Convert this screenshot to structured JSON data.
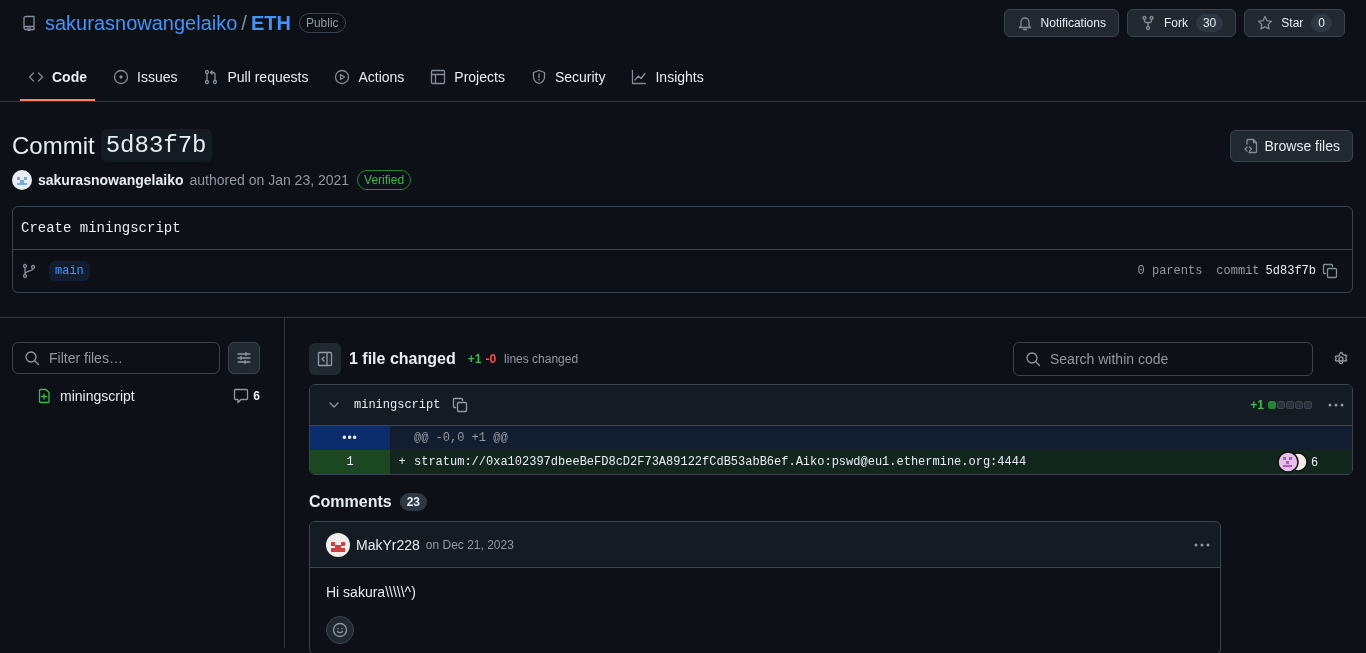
{
  "repo": {
    "owner": "sakurasnowangelaiko",
    "separator": "/",
    "name": "ETH",
    "visibility": "Public"
  },
  "repo_actions": [
    {
      "kind": "notifications",
      "label": "Notifications"
    },
    {
      "kind": "fork",
      "label": "Fork",
      "count": "30"
    },
    {
      "kind": "star",
      "label": "Star",
      "count": "0"
    }
  ],
  "tabs": [
    {
      "kind": "code",
      "label": "Code",
      "selected": true
    },
    {
      "kind": "issues",
      "label": "Issues",
      "selected": false
    },
    {
      "kind": "pulls",
      "label": "Pull requests",
      "selected": false
    },
    {
      "kind": "actions",
      "label": "Actions",
      "selected": false
    },
    {
      "kind": "projects",
      "label": "Projects",
      "selected": false
    },
    {
      "kind": "security",
      "label": "Security",
      "selected": false
    },
    {
      "kind": "insights",
      "label": "Insights",
      "selected": false
    }
  ],
  "commit": {
    "title": "Commit",
    "sha": "5d83f7b",
    "browse_button": "Browse files",
    "author": "sakurasnowangelaiko",
    "authored": "authored on Jan 23, 2021",
    "badge": "Verified",
    "message": "Create miningscript",
    "branch": "main",
    "parents": "0 parents",
    "commit_label": "commit",
    "commit_sha": "5d83f7b"
  },
  "file_tree": {
    "filter_placeholder": "Filter files…",
    "files": [
      {
        "name": "miningscript",
        "comments": "6",
        "selected": false
      }
    ]
  },
  "diff_summary": {
    "files_changed": "1 file changed",
    "additions": "+1",
    "deletions": "-0",
    "lines_changed": "lines changed",
    "search_placeholder": "Search within code"
  },
  "file_diff": {
    "filename": "miningscript",
    "expanded": true,
    "additions": "+1",
    "diffstat": [
      {
        "kind": "added"
      },
      {
        "kind": "neutral"
      },
      {
        "kind": "neutral"
      },
      {
        "kind": "neutral"
      },
      {
        "kind": "neutral"
      }
    ],
    "lines": [
      {
        "kind": "hunk",
        "number": "•••",
        "content": "@@ -0,0 +1 @@"
      },
      {
        "kind": "added",
        "number": "1",
        "marker": "+",
        "content": "stratum://0xa102397dbeeBeFD8cD2F73A89122fCdB53abB6ef.Aiko:pswd@eu1.ethermine.org:4444",
        "comment_count": "6"
      }
    ]
  },
  "comments": {
    "title": "Comments",
    "count": "23",
    "items": [
      {
        "author": "MakYr228",
        "date": "on Dec 21, 2023",
        "body": "Hi sakura\\\\\\\\\\^)"
      }
    ]
  }
}
